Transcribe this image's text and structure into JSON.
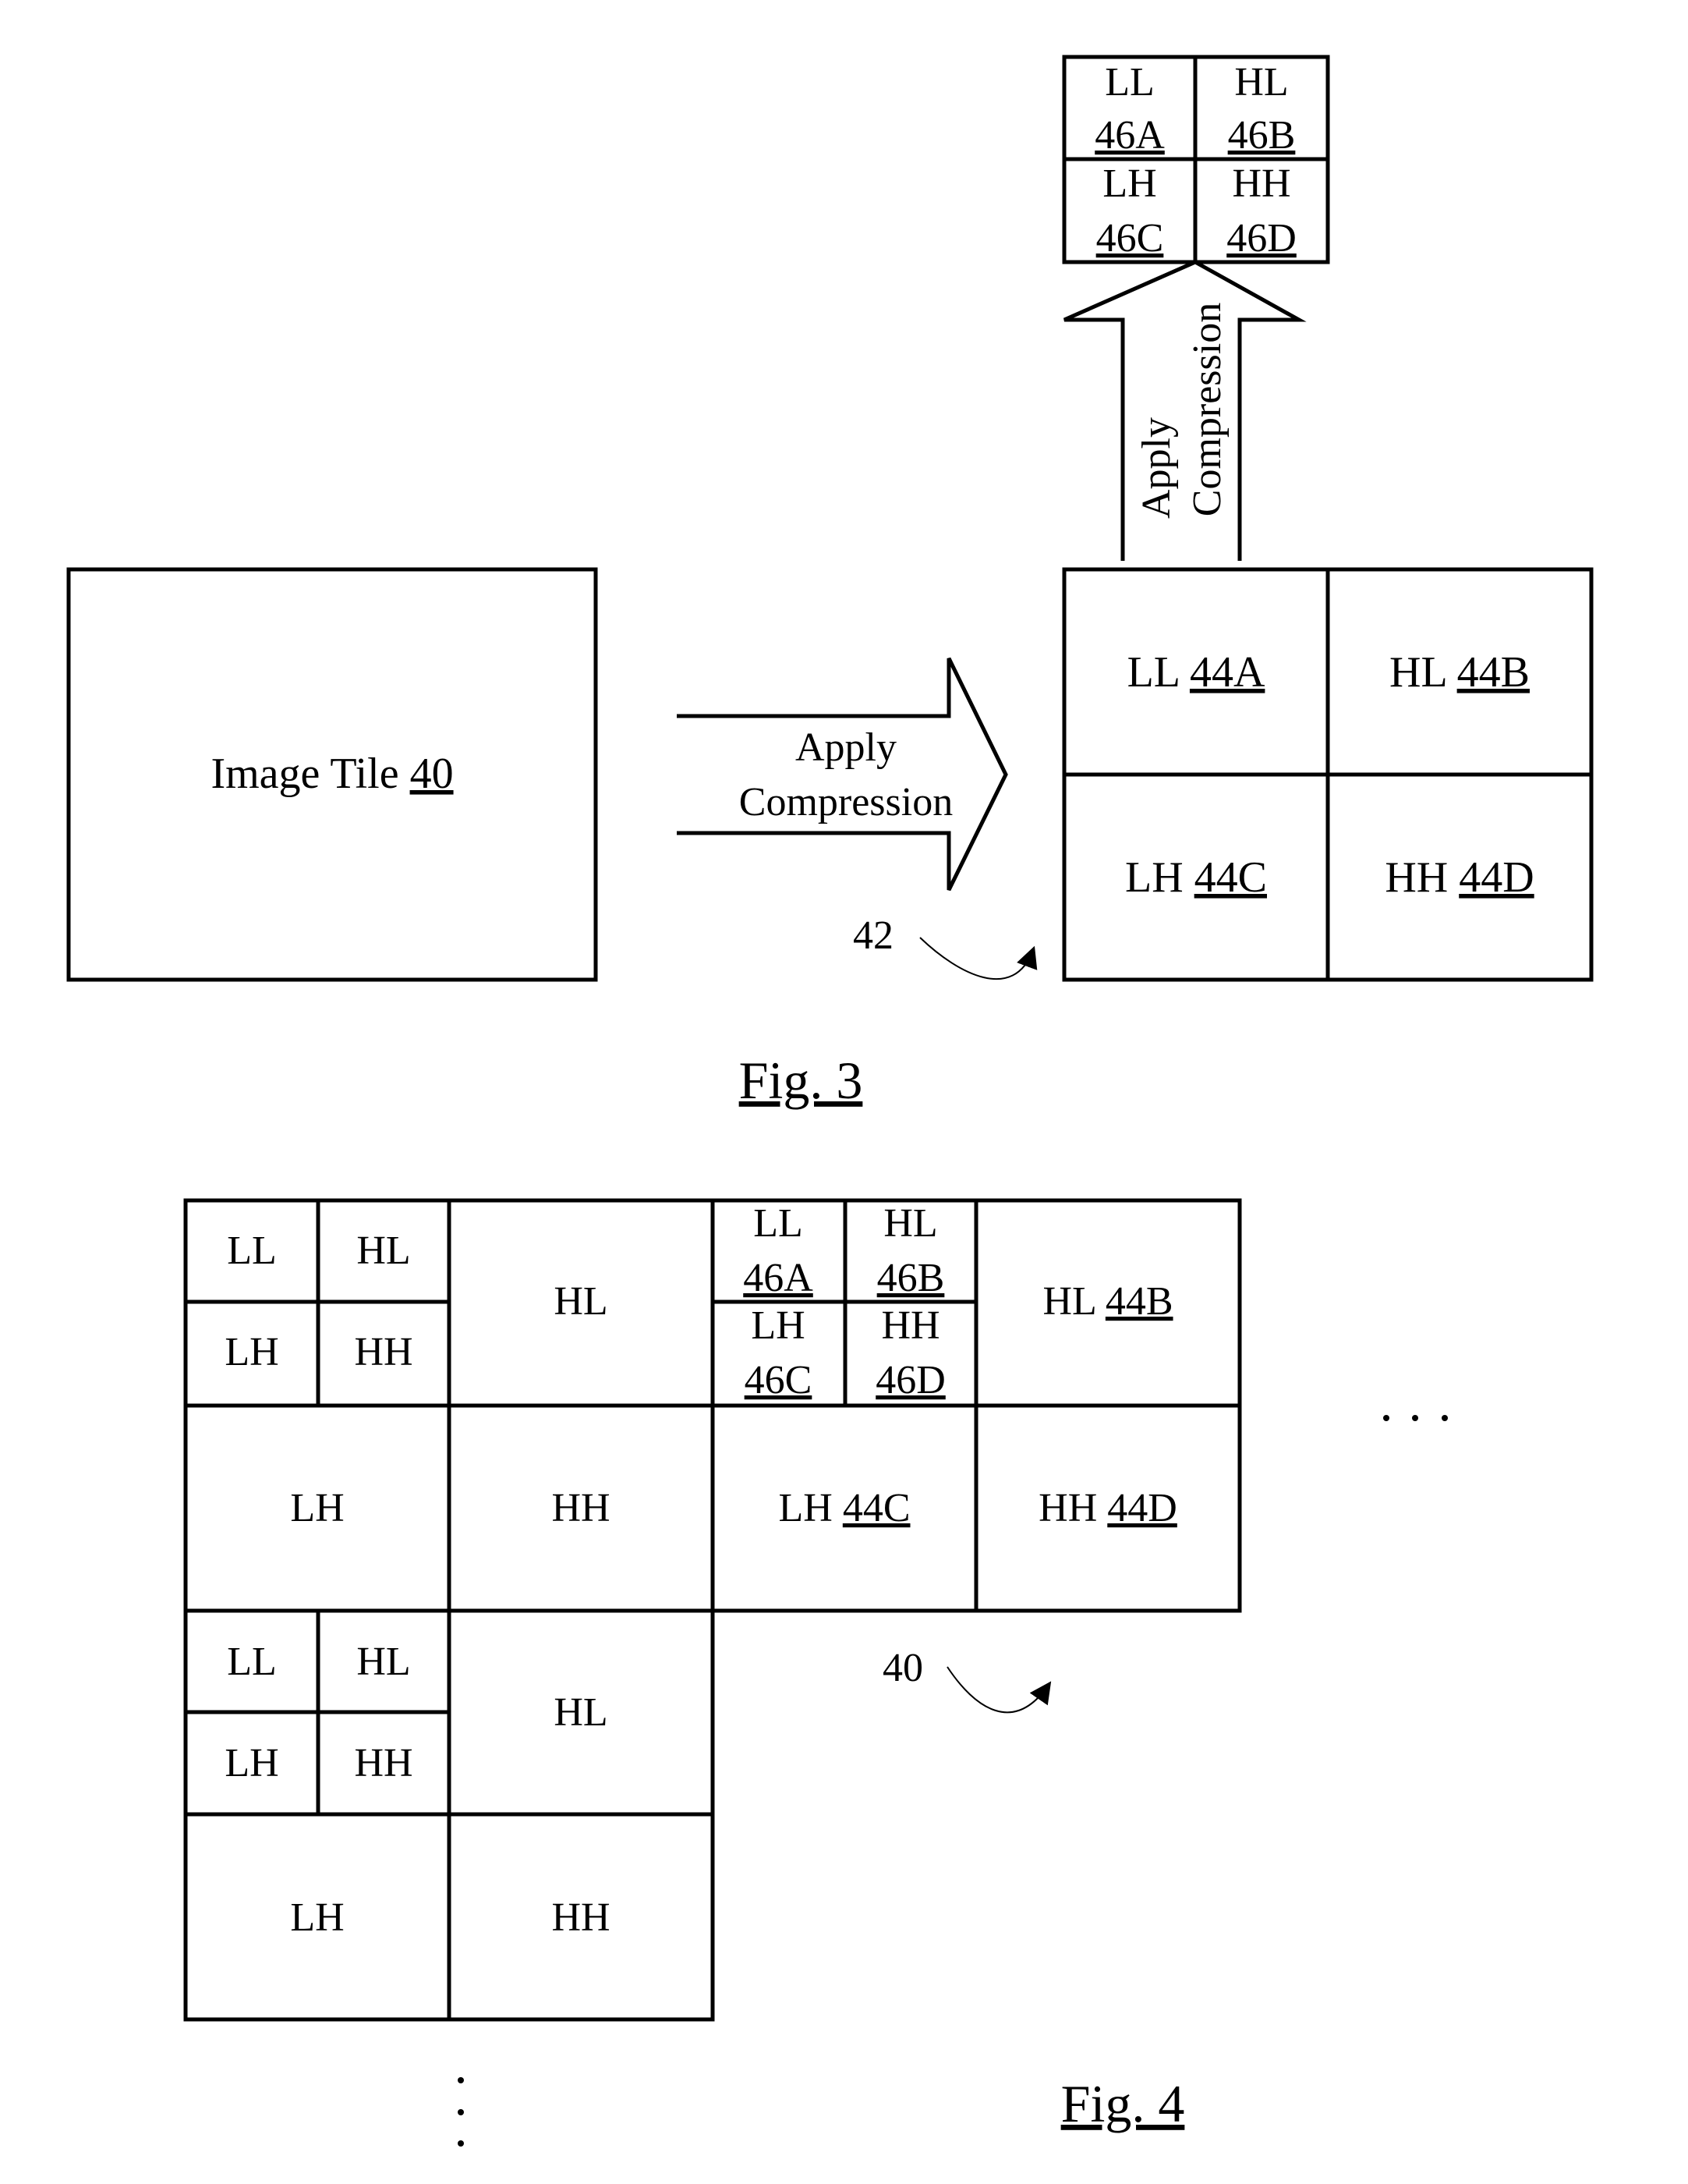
{
  "fig3": {
    "caption": "Fig. 3",
    "image_tile": {
      "label": "Image Tile ",
      "ref": "40"
    },
    "arrow_horizontal": {
      "line1": "Apply",
      "line2": "Compression"
    },
    "arrow_ref": "42",
    "level1_grid": [
      {
        "band": "LL ",
        "ref": "44A"
      },
      {
        "band": "HL ",
        "ref": "44B"
      },
      {
        "band": "LH ",
        "ref": "44C"
      },
      {
        "band": "HH ",
        "ref": "44D"
      }
    ],
    "arrow_vertical": {
      "line1": "Apply",
      "line2": "Compression"
    },
    "level2_grid": [
      {
        "band": "LL",
        "ref": "46A"
      },
      {
        "band": "HL",
        "ref": "46B"
      },
      {
        "band": "LH",
        "ref": "46C"
      },
      {
        "band": "HH",
        "ref": "46D"
      }
    ]
  },
  "fig4": {
    "caption": "Fig. 4",
    "tile_ref": "40",
    "tile1": {
      "sub_ll": "LL",
      "sub_hl": "HL",
      "sub_lh": "LH",
      "sub_hh": "HH",
      "hl": "HL",
      "lh": "LH",
      "hh": "HH"
    },
    "tile2": {
      "level2": [
        {
          "band": "LL",
          "ref": "46A"
        },
        {
          "band": "HL",
          "ref": "46B"
        },
        {
          "band": "LH",
          "ref": "46C"
        },
        {
          "band": "HH",
          "ref": "46D"
        }
      ],
      "hl": {
        "band": "HL ",
        "ref": "44B"
      },
      "lh": {
        "band": "LH ",
        "ref": "44C"
      },
      "hh": {
        "band": "HH ",
        "ref": "44D"
      }
    },
    "tile3": {
      "sub_ll": "LL",
      "sub_hl": "HL",
      "sub_lh": "LH",
      "sub_hh": "HH",
      "hl": "HL",
      "lh": "LH",
      "hh": "HH"
    },
    "ellipsis_horizontal": ". . .",
    "ellipsis_vertical": "⋮"
  }
}
